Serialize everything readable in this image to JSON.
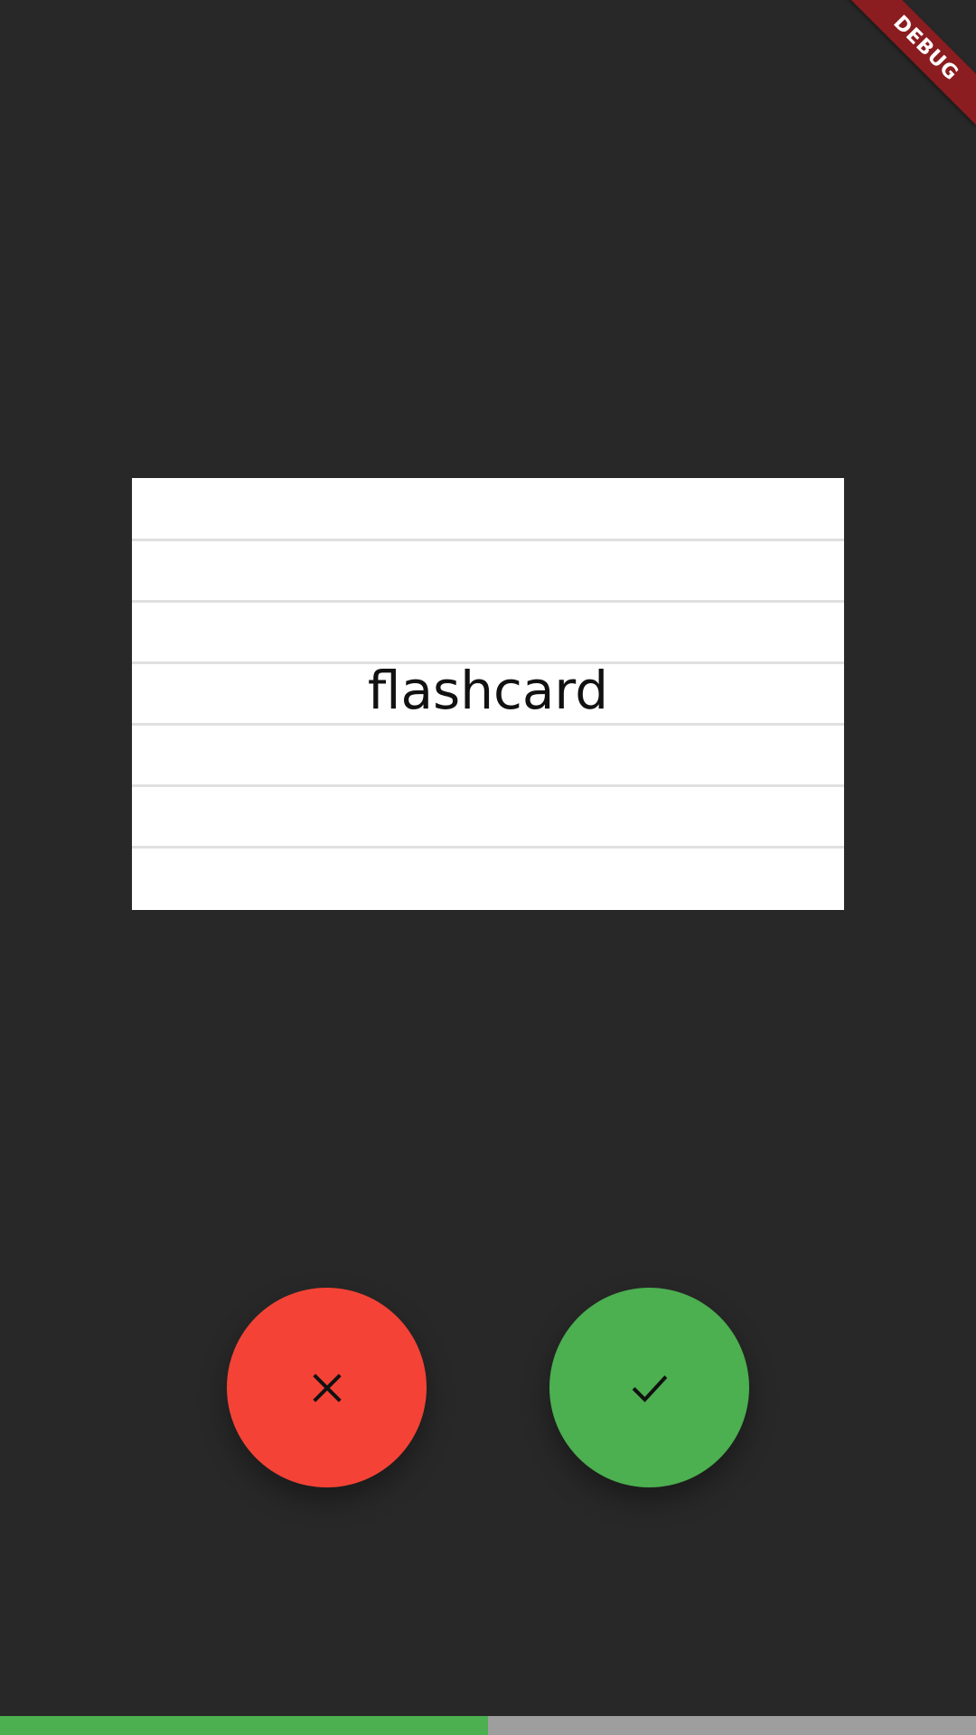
{
  "debug_banner": {
    "label": "DEBUG"
  },
  "flashcard": {
    "word": "flashcard"
  },
  "buttons": {
    "wrong": {
      "icon": "close-icon",
      "color": "#f44336"
    },
    "correct": {
      "icon": "check-icon",
      "color": "#4caf50"
    }
  },
  "progress": {
    "fraction": 0.5,
    "fill_color": "#4caf50",
    "track_color": "#9e9e9e"
  },
  "colors": {
    "background": "#282828",
    "card": "#ffffff",
    "card_lines": "#e0e0e0",
    "debug_banner": "#8b1c1f"
  }
}
